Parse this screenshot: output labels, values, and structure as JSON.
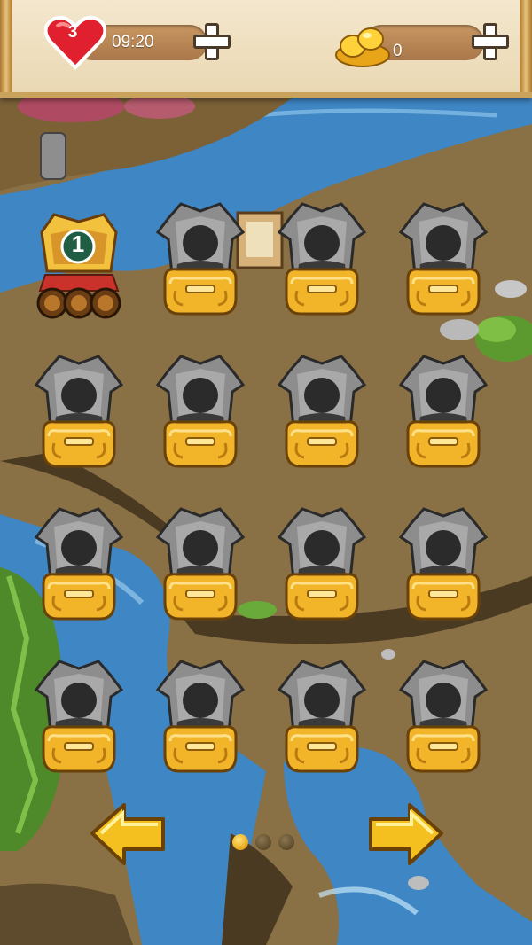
{
  "header": {
    "lives": "3",
    "timer": "09:20",
    "gold": "0"
  },
  "current_level": {
    "number": "1"
  },
  "levels": [
    {
      "row": 1,
      "col": 2,
      "state": "locked"
    },
    {
      "row": 1,
      "col": 3,
      "state": "locked"
    },
    {
      "row": 1,
      "col": 4,
      "state": "locked"
    },
    {
      "row": 2,
      "col": 1,
      "state": "locked"
    },
    {
      "row": 2,
      "col": 2,
      "state": "locked"
    },
    {
      "row": 2,
      "col": 3,
      "state": "locked"
    },
    {
      "row": 2,
      "col": 4,
      "state": "locked"
    },
    {
      "row": 3,
      "col": 1,
      "state": "locked"
    },
    {
      "row": 3,
      "col": 2,
      "state": "locked"
    },
    {
      "row": 3,
      "col": 3,
      "state": "locked"
    },
    {
      "row": 3,
      "col": 4,
      "state": "locked"
    },
    {
      "row": 4,
      "col": 1,
      "state": "locked"
    },
    {
      "row": 4,
      "col": 2,
      "state": "locked"
    },
    {
      "row": 4,
      "col": 3,
      "state": "locked"
    },
    {
      "row": 4,
      "col": 4,
      "state": "locked"
    }
  ],
  "pagination": {
    "pages": 3,
    "active": 1
  },
  "icons": {
    "lives": "heart-icon",
    "gold": "gold-ingot-icon",
    "add": "plus-icon",
    "prev": "arrow-left-icon",
    "next": "arrow-right-icon",
    "locked_level": "locked-level-icon"
  },
  "colors": {
    "river": "#3f86c4",
    "ground": "#8a7045",
    "gold": "#e9a51a",
    "heart": "#e0202e"
  }
}
